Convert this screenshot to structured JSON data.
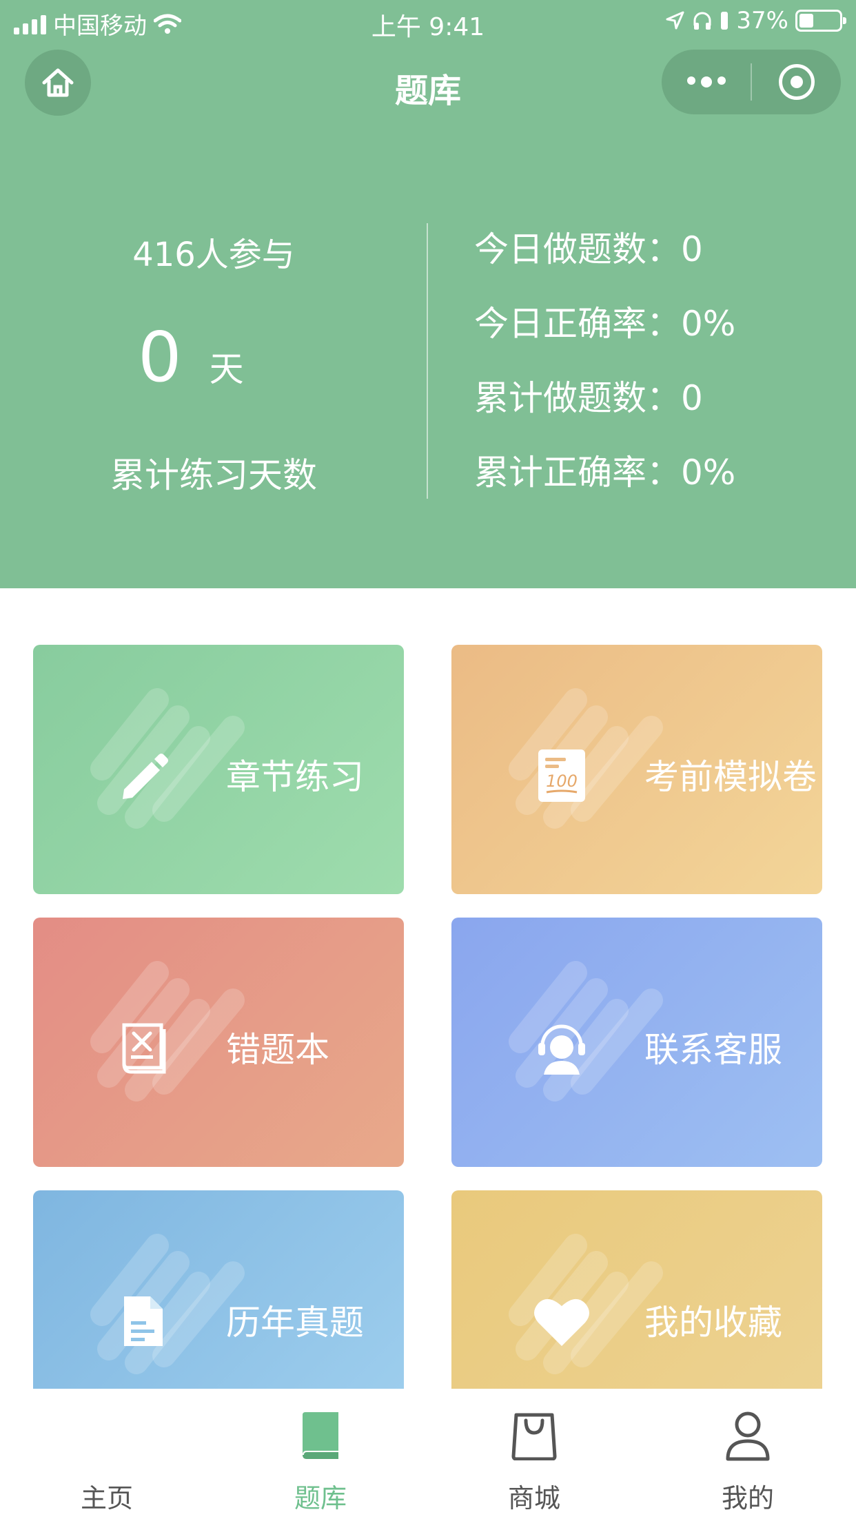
{
  "status_bar": {
    "carrier": "中国移动",
    "time": "上午 9:41",
    "battery": "37%"
  },
  "nav": {
    "title": "题库"
  },
  "summary": {
    "participants": "416人参与",
    "days_value": "0",
    "days_unit": "天",
    "days_label": "累计练习天数",
    "stats": [
      "今日做题数：0",
      "今日正确率：0%",
      "累计做题数：0",
      "累计正确率：0%"
    ]
  },
  "tiles": [
    {
      "label": "章节练习",
      "icon": "pencil-icon",
      "color": "#88cc9e"
    },
    {
      "label": "考前模拟卷",
      "icon": "exam-paper-icon",
      "color": "#ebbb85"
    },
    {
      "label": "错题本",
      "icon": "wrong-book-icon",
      "color": "#e38d85"
    },
    {
      "label": "联系客服",
      "icon": "customer-service-icon",
      "color": "#8aa6ee"
    },
    {
      "label": "历年真题",
      "icon": "document-icon",
      "color": "#7fb6e0"
    },
    {
      "label": "我的收藏",
      "icon": "heart-icon",
      "color": "#e9c97c"
    }
  ],
  "exam_icon_text": "100",
  "tabbar": {
    "active_color": "#6fc08e",
    "items": [
      {
        "label": "主页",
        "icon": "home-icon"
      },
      {
        "label": "题库",
        "icon": "book-icon"
      },
      {
        "label": "商城",
        "icon": "shopping-bag-icon"
      },
      {
        "label": "我的",
        "icon": "user-icon"
      }
    ]
  },
  "colors": {
    "header_bg": "#80bf95"
  }
}
